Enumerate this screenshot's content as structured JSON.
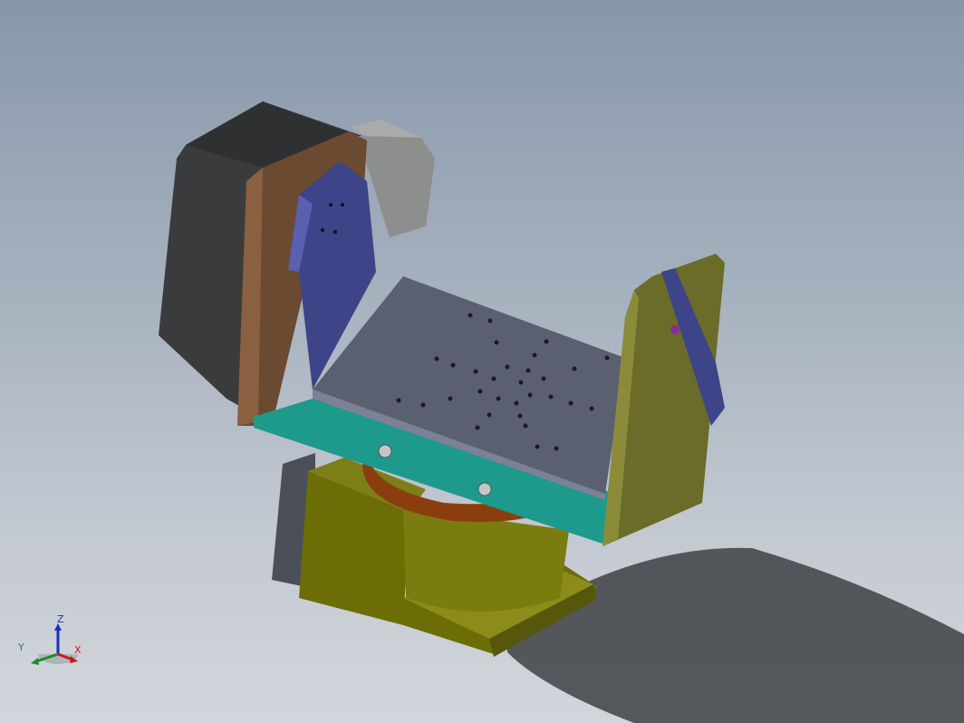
{
  "triad": {
    "x_label": "X",
    "y_label": "Y",
    "z_label": "Z",
    "colors": {
      "x": "#c61b1b",
      "y": "#1c8a2a",
      "z": "#1a2ec4"
    }
  },
  "colors": {
    "background_top": "#8797aa",
    "background_bottom": "#d2d6dc",
    "motor_body": "#3a3b3d",
    "motor_flange": "#6b4a32",
    "side_bracket_purple": "#3e4488",
    "platform_top": "#5b6071",
    "platform_base": "#1d9a8c",
    "side_plate_olive": "#6b6b2a",
    "gearbox_yellow": "#8a8a10",
    "turntable_orange": "#9a4a12",
    "shaft_gray": "#9b9d9c"
  }
}
